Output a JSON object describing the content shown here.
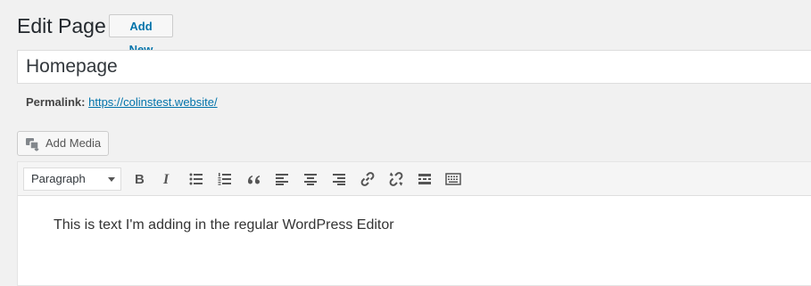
{
  "header": {
    "title": "Edit Page",
    "add_new_label": "Add New"
  },
  "post": {
    "title": "Homepage",
    "permalink_label": "Permalink:",
    "permalink_url": "https://colinstest.website/"
  },
  "media": {
    "add_media_label": "Add Media"
  },
  "toolbar": {
    "format_value": "Paragraph",
    "buttons": [
      "bold-icon",
      "italic-icon",
      "bulleted-list-icon",
      "numbered-list-icon",
      "blockquote-icon",
      "align-left-icon",
      "align-center-icon",
      "align-right-icon",
      "insert-link-icon",
      "remove-link-icon",
      "read-more-icon",
      "toolbar-toggle-icon"
    ]
  },
  "editor": {
    "content": "This is text I'm adding in the regular WordPress Editor"
  },
  "colors": {
    "link": "#0073aa",
    "background": "#f1f1f1",
    "icon": "#555555"
  }
}
